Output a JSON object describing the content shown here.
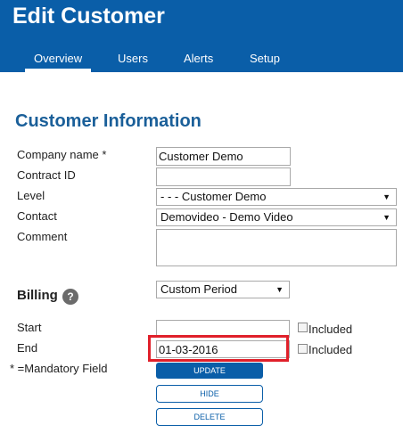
{
  "header": {
    "title": "Edit Customer",
    "tabs": [
      {
        "label": "Overview",
        "active": true
      },
      {
        "label": "Users"
      },
      {
        "label": "Alerts"
      },
      {
        "label": "Setup"
      }
    ]
  },
  "customer_info": {
    "section_title": "Customer Information",
    "company_name": {
      "label": "Company name *",
      "value": "Customer Demo"
    },
    "contract_id": {
      "label": "Contract ID",
      "value": ""
    },
    "level": {
      "label": "Level",
      "value": "- - - Customer Demo"
    },
    "contact": {
      "label": "Contact",
      "value": "Demovideo - Demo Video"
    },
    "comment": {
      "label": "Comment",
      "value": ""
    }
  },
  "billing": {
    "title": "Billing",
    "help_symbol": "?",
    "period": "Custom Period",
    "start": {
      "label": "Start",
      "value": "",
      "included_label": "Included"
    },
    "end": {
      "label": "End",
      "value": "01-03-2016",
      "included_label": "Included"
    }
  },
  "footer": {
    "mandatory_note": "* =Mandatory Field",
    "update_label": "UPDATE",
    "hide_label": "HIDE",
    "delete_label": "DELETE"
  },
  "colors": {
    "brand_blue": "#0a5ea8",
    "highlight_red": "#e0202a",
    "section_title": "#1a5f99"
  }
}
